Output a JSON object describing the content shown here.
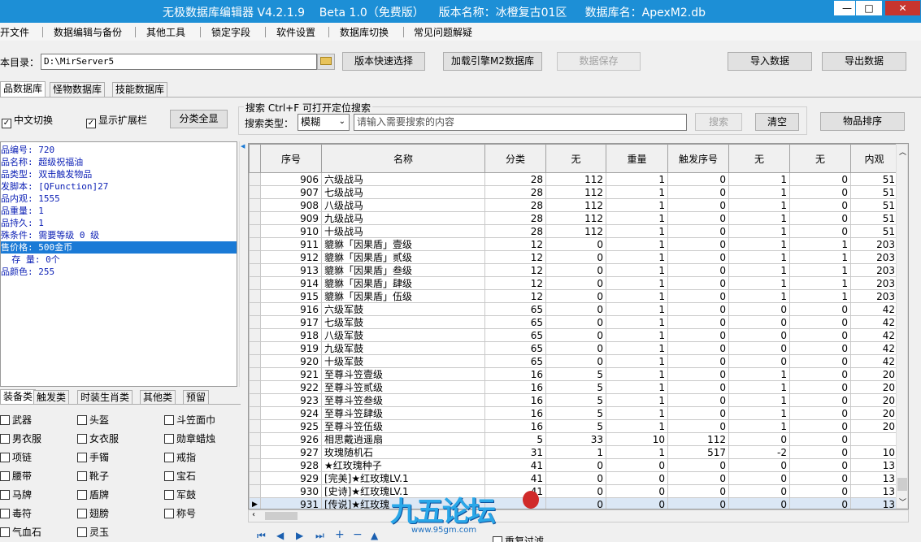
{
  "window": {
    "title": "无极数据库编辑器 V4.2.1.9    Beta 1.0（免费版）    版本名称：冰橙复古01区     数据库名：ApexM2.db",
    "min": "—",
    "max": "□",
    "close": "✕"
  },
  "menu": [
    "开文件",
    "数据编辑与备份",
    "其他工具",
    "锁定字段",
    "软件设置",
    "数据库切换",
    "常见问题解疑"
  ],
  "toolbar": {
    "dir_label": "本目录：",
    "dir_value": "D:\\MirServer5",
    "version_btn": "版本快速选择",
    "load_btn": "加载引擎M2数据库",
    "save_btn": "数据保存",
    "import_btn": "导入数据",
    "export_btn": "导出数据"
  },
  "db_tabs": [
    "品数据库",
    "怪物数据库",
    "技能数据库"
  ],
  "options": {
    "cn_switch": "中文切换",
    "show_ext": "显示扩展栏",
    "show_all": "分类全显"
  },
  "search": {
    "header": "搜索   Ctrl+F 可打开定位搜索",
    "type_label": "搜索类型：",
    "type_value": "模糊",
    "placeholder": "请输入需要搜索的内容",
    "search_btn": "搜索",
    "clear_btn": "清空"
  },
  "sort_btn": "物品排序",
  "detail": [
    "品编号: 720",
    "品名称: 超级祝福油",
    "品类型: 双击触发物品",
    "发脚本: [QFunction]27",
    "品内观: 1555",
    "品重量: 1",
    "品持久: 1",
    "殊条件: 需要等级 0 级",
    "售价格: 500金币",
    "  存 量: 0个",
    "品颜色: 255"
  ],
  "detail_selected_index": 8,
  "grid": {
    "columns": [
      "序号",
      "名称",
      "分类",
      "无",
      "重量",
      "触发序号",
      "无",
      "无",
      "内观"
    ],
    "rows": [
      [
        "906",
        "六级战马",
        "28",
        "112",
        "1",
        "0",
        "1",
        "0",
        "51"
      ],
      [
        "907",
        "七级战马",
        "28",
        "112",
        "1",
        "0",
        "1",
        "0",
        "51"
      ],
      [
        "908",
        "八级战马",
        "28",
        "112",
        "1",
        "0",
        "1",
        "0",
        "51"
      ],
      [
        "909",
        "九级战马",
        "28",
        "112",
        "1",
        "0",
        "1",
        "0",
        "51"
      ],
      [
        "910",
        "十级战马",
        "28",
        "112",
        "1",
        "0",
        "1",
        "0",
        "51"
      ],
      [
        "911",
        "貔貅「因果盾」壹级",
        "12",
        "0",
        "1",
        "0",
        "1",
        "1",
        "203"
      ],
      [
        "912",
        "貔貅「因果盾」贰级",
        "12",
        "0",
        "1",
        "0",
        "1",
        "1",
        "203"
      ],
      [
        "913",
        "貔貅「因果盾」叁级",
        "12",
        "0",
        "1",
        "0",
        "1",
        "1",
        "203"
      ],
      [
        "914",
        "貔貅「因果盾」肆级",
        "12",
        "0",
        "1",
        "0",
        "1",
        "1",
        "203"
      ],
      [
        "915",
        "貔貅「因果盾」伍级",
        "12",
        "0",
        "1",
        "0",
        "1",
        "1",
        "203"
      ],
      [
        "916",
        "六级军鼓",
        "65",
        "0",
        "1",
        "0",
        "0",
        "0",
        "42"
      ],
      [
        "917",
        "七级军鼓",
        "65",
        "0",
        "1",
        "0",
        "0",
        "0",
        "42"
      ],
      [
        "918",
        "八级军鼓",
        "65",
        "0",
        "1",
        "0",
        "0",
        "0",
        "42"
      ],
      [
        "919",
        "九级军鼓",
        "65",
        "0",
        "1",
        "0",
        "0",
        "0",
        "42"
      ],
      [
        "920",
        "十级军鼓",
        "65",
        "0",
        "1",
        "0",
        "0",
        "0",
        "42"
      ],
      [
        "921",
        "至尊斗笠壹级",
        "16",
        "5",
        "1",
        "0",
        "1",
        "0",
        "20"
      ],
      [
        "922",
        "至尊斗笠贰级",
        "16",
        "5",
        "1",
        "0",
        "1",
        "0",
        "20"
      ],
      [
        "923",
        "至尊斗笠叁级",
        "16",
        "5",
        "1",
        "0",
        "1",
        "0",
        "20"
      ],
      [
        "924",
        "至尊斗笠肆级",
        "16",
        "5",
        "1",
        "0",
        "1",
        "0",
        "20"
      ],
      [
        "925",
        "至尊斗笠伍级",
        "16",
        "5",
        "1",
        "0",
        "1",
        "0",
        "20"
      ],
      [
        "926",
        "相思戴逍遥扇",
        "5",
        "33",
        "10",
        "112",
        "0",
        "0",
        ""
      ],
      [
        "927",
        "玫瑰随机石",
        "31",
        "1",
        "1",
        "517",
        "-2",
        "0",
        "10"
      ],
      [
        "928",
        "★红玫瑰种子",
        "41",
        "0",
        "0",
        "0",
        "0",
        "0",
        "13"
      ],
      [
        "929",
        "[完美]★红玫瑰LV.1",
        "41",
        "0",
        "0",
        "0",
        "0",
        "0",
        "13"
      ],
      [
        "930",
        "[史诗]★红玫瑰LV.1",
        "41",
        "0",
        "0",
        "0",
        "0",
        "0",
        "13"
      ],
      [
        "931",
        "[传说]★红玫瑰",
        "",
        "0",
        "0",
        "0",
        "0",
        "0",
        "13"
      ]
    ]
  },
  "cat_tabs": [
    "装备类",
    "触发类",
    "时装生肖类",
    "其他类",
    "预留"
  ],
  "categories": [
    [
      "武器",
      "头盔",
      "斗笠面巾"
    ],
    [
      "男衣服",
      "女衣服",
      "勋章蜡烛"
    ],
    [
      "项链",
      "手镯",
      "戒指"
    ],
    [
      "腰带",
      "靴子",
      "宝石"
    ],
    [
      "马牌",
      "盾牌",
      "军鼓"
    ],
    [
      "毒符",
      "翅膀",
      "称号"
    ],
    [
      "气血石",
      "灵玉",
      ""
    ]
  ],
  "bottom_filter": "重复过滤",
  "watermark": {
    "brand": "九五论坛",
    "url": "www.95gm.com"
  },
  "colors": {
    "titlebar": "#1d8fd6",
    "selection": "#1a7ad6",
    "detail_text": "#0b1fb5"
  }
}
